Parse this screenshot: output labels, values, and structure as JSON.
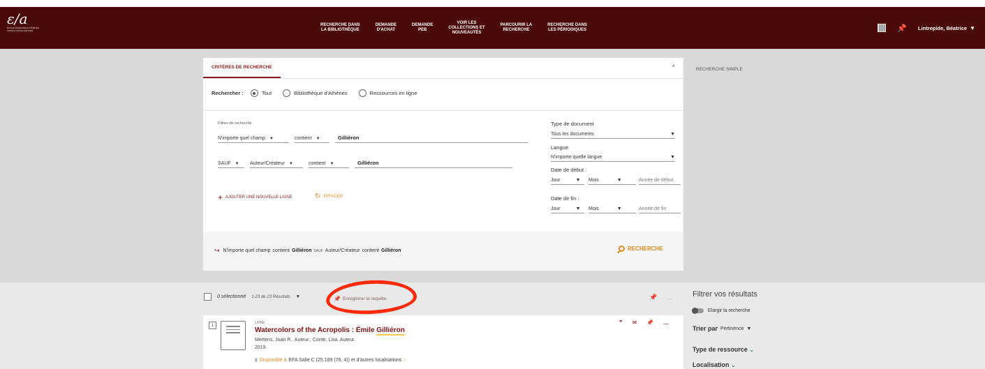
{
  "header": {
    "logo_mark": "ε/a",
    "logo_sub_1": "ÉCOLE FRANÇAISE D'ATHÈNES",
    "logo_sub_2": "ΓΑΛΛΙΚΗ ΣΧΟΛΗ ΑΘΗΝΩΝ",
    "nav": [
      {
        "label": "RECHERCHE DANS\nLA BIBLIOTHÈQUE"
      },
      {
        "label": "DEMANDE\nD'ACHAT"
      },
      {
        "label": "DEMANDE\nPEB"
      },
      {
        "label": "VOIR LES\nCOLLECTIONS ET\nNOUVEAUTÉS"
      },
      {
        "label": "PARCOURIR LA\nRECHERCHE"
      },
      {
        "label": "RECHERCHE DANS\nLES PÉRIODIQUES"
      }
    ],
    "user": "Lintrepide, Béatrice",
    "icons": [
      "qr-code-icon",
      "pin-icon",
      "caret-down-icon"
    ]
  },
  "search": {
    "tab_label": "CRITÈRES DE RECHERCHE",
    "simple_link": "RECHERCHE SIMPLE",
    "scope_label": "Rechercher :",
    "scope_options": [
      "Tout",
      "Bibliothèque d'Athènes",
      "Ressources en ligne"
    ],
    "scope_selected": "Tout",
    "filters_title": "Filtres de recherche",
    "row1": {
      "field": "N'importe quel champ",
      "op": "contient",
      "term": "Gilliéron"
    },
    "row2": {
      "bool": "SAUF",
      "field": "Auteur/Créateur",
      "op": "contient",
      "term": "Gilliéron"
    },
    "add_line": "AJOUTER UNE NOUVELLE LIGNE",
    "clear": "EFFACER",
    "doc_type_label": "Type de document",
    "doc_type_value": "Tous les documents",
    "lang_label": "Langue",
    "lang_value": "N'importe quelle langue",
    "start_label": "Date de début :",
    "end_label": "Date de fin :",
    "day": "Jour",
    "month": "Mois",
    "start_year_placeholder": "Année de début",
    "end_year_placeholder": "Année de fin",
    "summary": {
      "f1": "N'importe quel champ",
      "op1": "contient",
      "t1": "Gilliéron",
      "bool": "SAUF",
      "f2": "Auteur/Créateur",
      "op2": "contient",
      "t2": "Gilliéron"
    },
    "search_button": "RECHERCHE"
  },
  "results": {
    "selected": "0 sélectionné",
    "count": "1-23 de 23 Résultats",
    "save_query": "Enregistrer la requête",
    "items": [
      {
        "num": "1",
        "type": "LIVRE",
        "title_prefix": "Watercolors of the Acropolis : Émile ",
        "title_highlight": "Gilliéron",
        "authors": "Mertens, Joan R.. Auteur.; Conte, Lisa. Auteur.",
        "year": "2019",
        "avail": "Disponible à",
        "location": "EFA  Salle C (25.189 (76, 4)) et d'autres localisations",
        "chevron": "›"
      }
    ]
  },
  "facets": {
    "title": "Filtrer vos résultats",
    "expand": "Elargir la recherche",
    "sort_label": "Trier par",
    "sort_value": "Pertinence",
    "type_label": "Type de ressource",
    "loc_label": "Localisation"
  },
  "colors": {
    "header": "#4a0a0a",
    "accent": "#8b1a1a",
    "orange": "#e08a1e",
    "annotation": "#ff2a0a"
  }
}
